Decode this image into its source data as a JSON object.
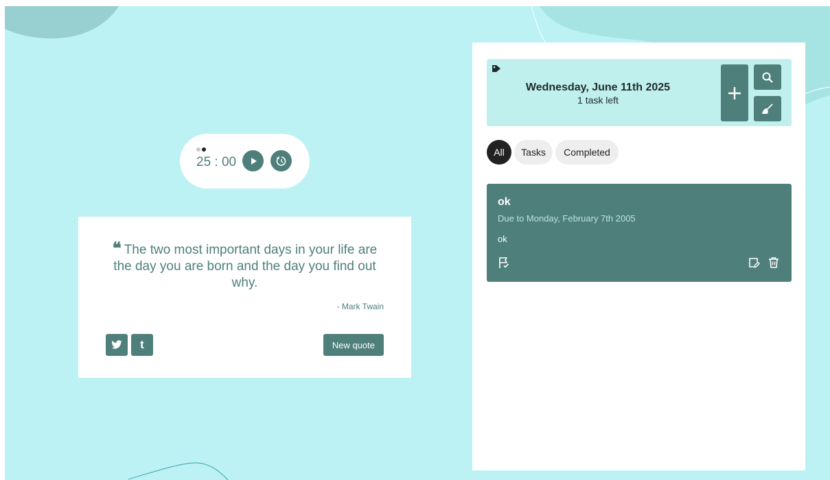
{
  "colors": {
    "background": "#bcf2f4",
    "accent": "#4e7f7b",
    "header_bg": "#bff0ee",
    "filter_active": "#222222",
    "filter_inactive": "#eeeeee"
  },
  "pomodoro": {
    "timer": "25 : 00",
    "icons": {
      "play": "play-icon",
      "reset": "timer-reset-icon"
    }
  },
  "quote": {
    "mark": "❝",
    "text": "The two most important days in your life are the day you are born and the day you find out why.",
    "author": "- Mark Twain",
    "share": {
      "twitter": "twitter-icon",
      "tumblr": "t"
    },
    "new_quote_label": "New quote"
  },
  "todo": {
    "date": "Wednesday, June 11th 2025",
    "tasks_left": "1 task left",
    "icons": {
      "logo": "tag-icon",
      "add": "plus-icon",
      "search": "search-icon",
      "clear": "broom-icon"
    },
    "filters": [
      {
        "label": "All",
        "active": true
      },
      {
        "label": "Tasks",
        "active": false
      },
      {
        "label": "Completed",
        "active": false
      }
    ],
    "tasks": [
      {
        "title": "ok",
        "due": "Due to Monday, February 7th 2005",
        "description": "ok",
        "icons": {
          "flag": "flag-check-icon",
          "edit": "edit-icon",
          "delete": "trash-icon"
        }
      }
    ]
  }
}
